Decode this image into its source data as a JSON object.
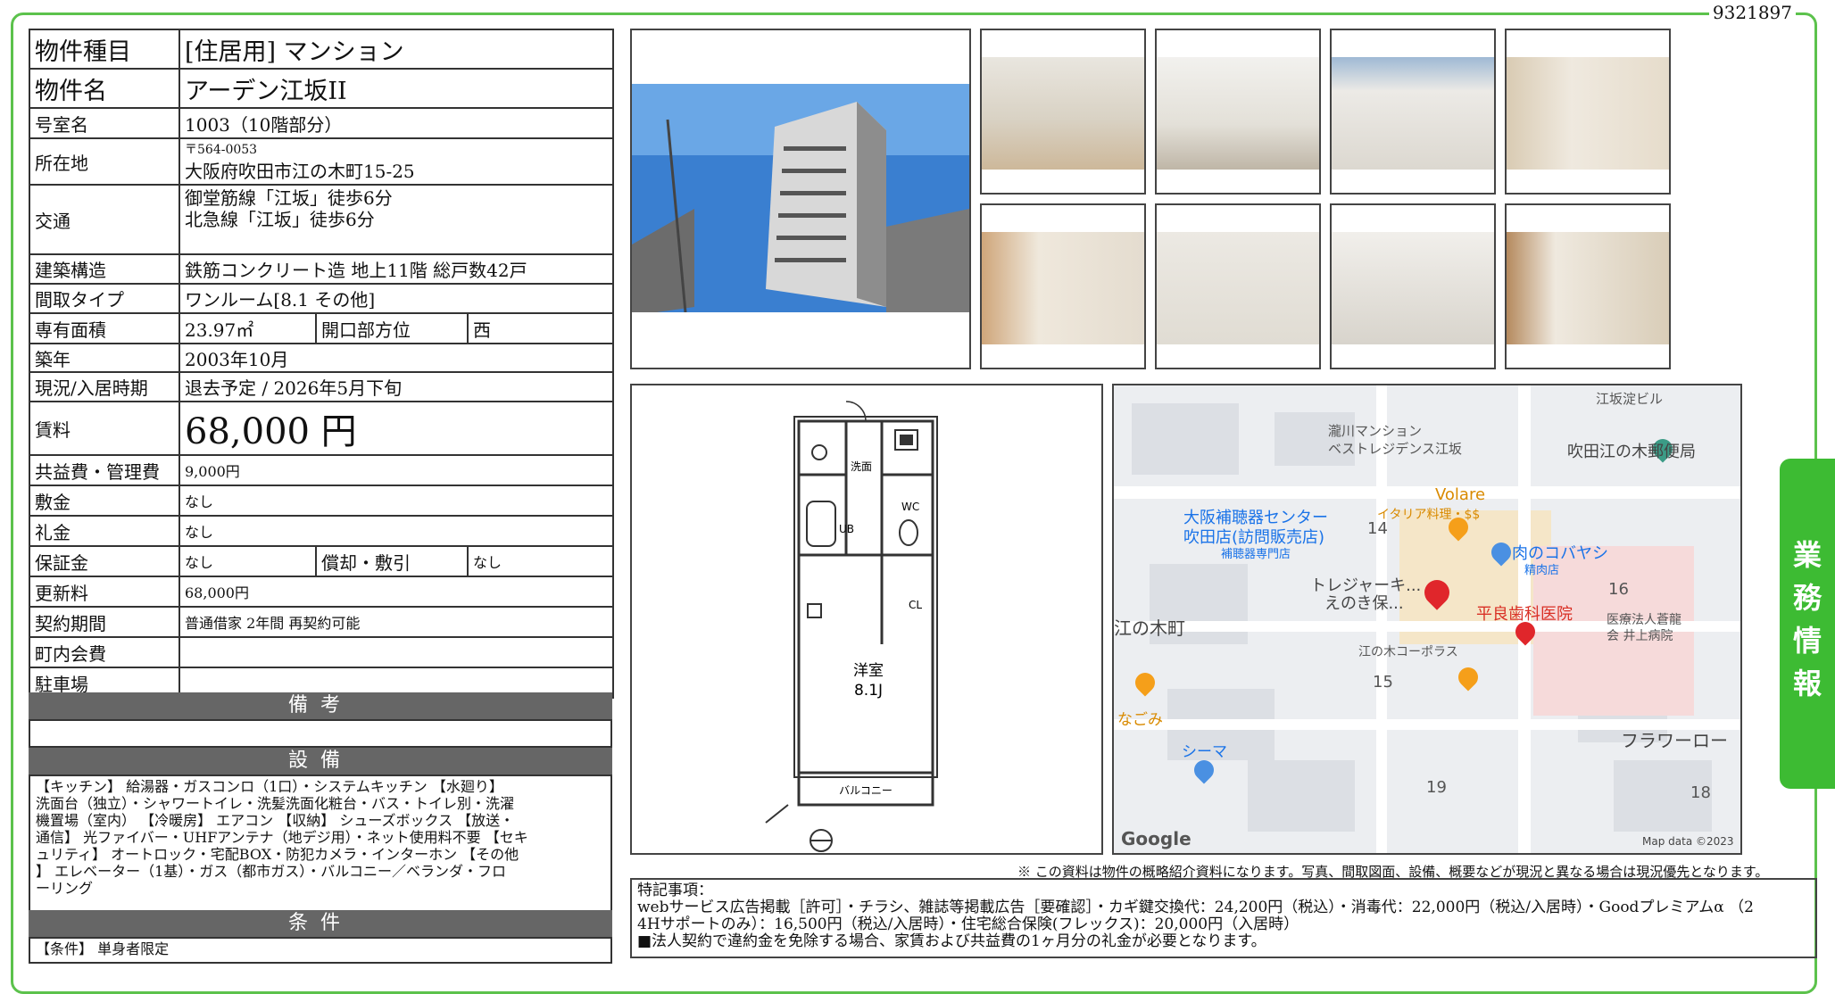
{
  "doc_id": "9321897",
  "spec": {
    "type_label": "物件種目",
    "type_value": "[住居用]  マンション",
    "name_label": "物件名",
    "name_value": "アーデン江坂II",
    "room_label": "号室名",
    "room_value": "1003（10階部分）",
    "address_label": "所在地",
    "zip": "〒564-0053",
    "address_value": "大阪府吹田市江の木町15-25",
    "transport_label": "交通",
    "transport_1": "御堂筋線「江坂」徒歩6分",
    "transport_2": "北急線「江坂」徒歩6分",
    "structure_label": "建築構造",
    "structure_value": "鉄筋コンクリート造  地上11階  総戸数42戸",
    "layout_label": "間取タイプ",
    "layout_value": "ワンルーム[8.1  その他]",
    "area_label": "専有面積",
    "area_value": "23.97㎡",
    "direction_label": "開口部方位",
    "direction_value": "西",
    "built_label": "築年",
    "built_value": "2003年10月",
    "status_label": "現況/入居時期",
    "status_value": "退去予定  /  2026年5月下旬",
    "rent_label": "賃料",
    "rent_value": "68,000 円",
    "fee_label": "共益費・管理費",
    "fee_value": "9,000円",
    "deposit_label": "敷金",
    "deposit_value": "なし",
    "key_label": "礼金",
    "key_value": "なし",
    "guarantee_label": "保証金",
    "guarantee_value": "なし",
    "amort_label": "償却・敷引",
    "amort_value": "なし",
    "renewal_label": "更新料",
    "renewal_value": "68,000円",
    "contract_label": "契約期間",
    "contract_value": "普通借家  2年間  再契約可能",
    "town_label": "町内会費",
    "town_value": "",
    "parking_label": "駐車場",
    "parking_value": ""
  },
  "sections": {
    "remarks_title": "備考",
    "equipment_title": "設備",
    "equipment_text": "【キッチン】 給湯器・ガスコンロ（1口）・システムキッチン 【水廻り】\n洗面台（独立）・シャワートイレ・洗髪洗面化粧台・バス・トイレ別・洗濯\n機置場（室内） 【冷暖房】 エアコン 【収納】 シューズボックス 【放送・\n通信】 光ファイバー・UHFアンテナ（地デジ用）・ネット使用料不要 【セキ\nュリティ】 オートロック・宅配BOX・防犯カメラ・インターホン 【その他\n】 エレベーター（1基）・ガス（都市ガス）・バルコニー／ベランダ・フロ\nーリング",
    "conditions_title": "条件",
    "conditions_text": "【条件】 単身者限定"
  },
  "floorplan": {
    "room_label": "洋室",
    "room_size": "8.1J",
    "balcony": "バルコニー",
    "wash": "洗面",
    "ub": "UB",
    "wc": "WC",
    "cl": "CL"
  },
  "map": {
    "labels": [
      "江坂淀ビル",
      "瀧川マンション",
      "ベストレジデンス江坂",
      "吹田江の木郵便局",
      "Volare",
      "イタリア料理・$$",
      "大阪補聴器センター",
      "吹田店(訪問販売店)",
      "補聴器専門店",
      "14",
      "肉のコバヤシ",
      "精肉店",
      "トレジャーキ...",
      "えのき保...",
      "平良歯科医院",
      "16",
      "医療法人蒼龍",
      "会 井上病院",
      "江の木町",
      "江の木コーポラス",
      "15",
      "なごみ",
      "シーマ",
      "フラワーロー",
      "19",
      "18"
    ],
    "google": "Google",
    "copyright": "Map data ©2023"
  },
  "notice": "※ この資料は物件の概略紹介資料になります。写真、間取図面、設備、概要などが現況と異なる場合は現況優先となります。",
  "remarks_box": "特記事項：\nwebサービス広告掲載［許可］・チラシ、雑誌等掲載広告［要確認］・カギ鍵交換代：24,200円（税込）・消毒代：22,000円（税込/入居時）・Goodプレミアムα （2\n4Hサポートのみ）：16,500円（税込/入居時）・住宅総合保険(フレックス)：20,000円（入居時）\n■法人契約で違約金を免除する場合、家賃および共益費の1ヶ月分の礼金が必要となります。",
  "side_tab": [
    "業",
    "務",
    "情",
    "報"
  ],
  "colors": {
    "accent": "#5cc24c",
    "tab": "#3dbb33",
    "section_bar": "#666666"
  }
}
